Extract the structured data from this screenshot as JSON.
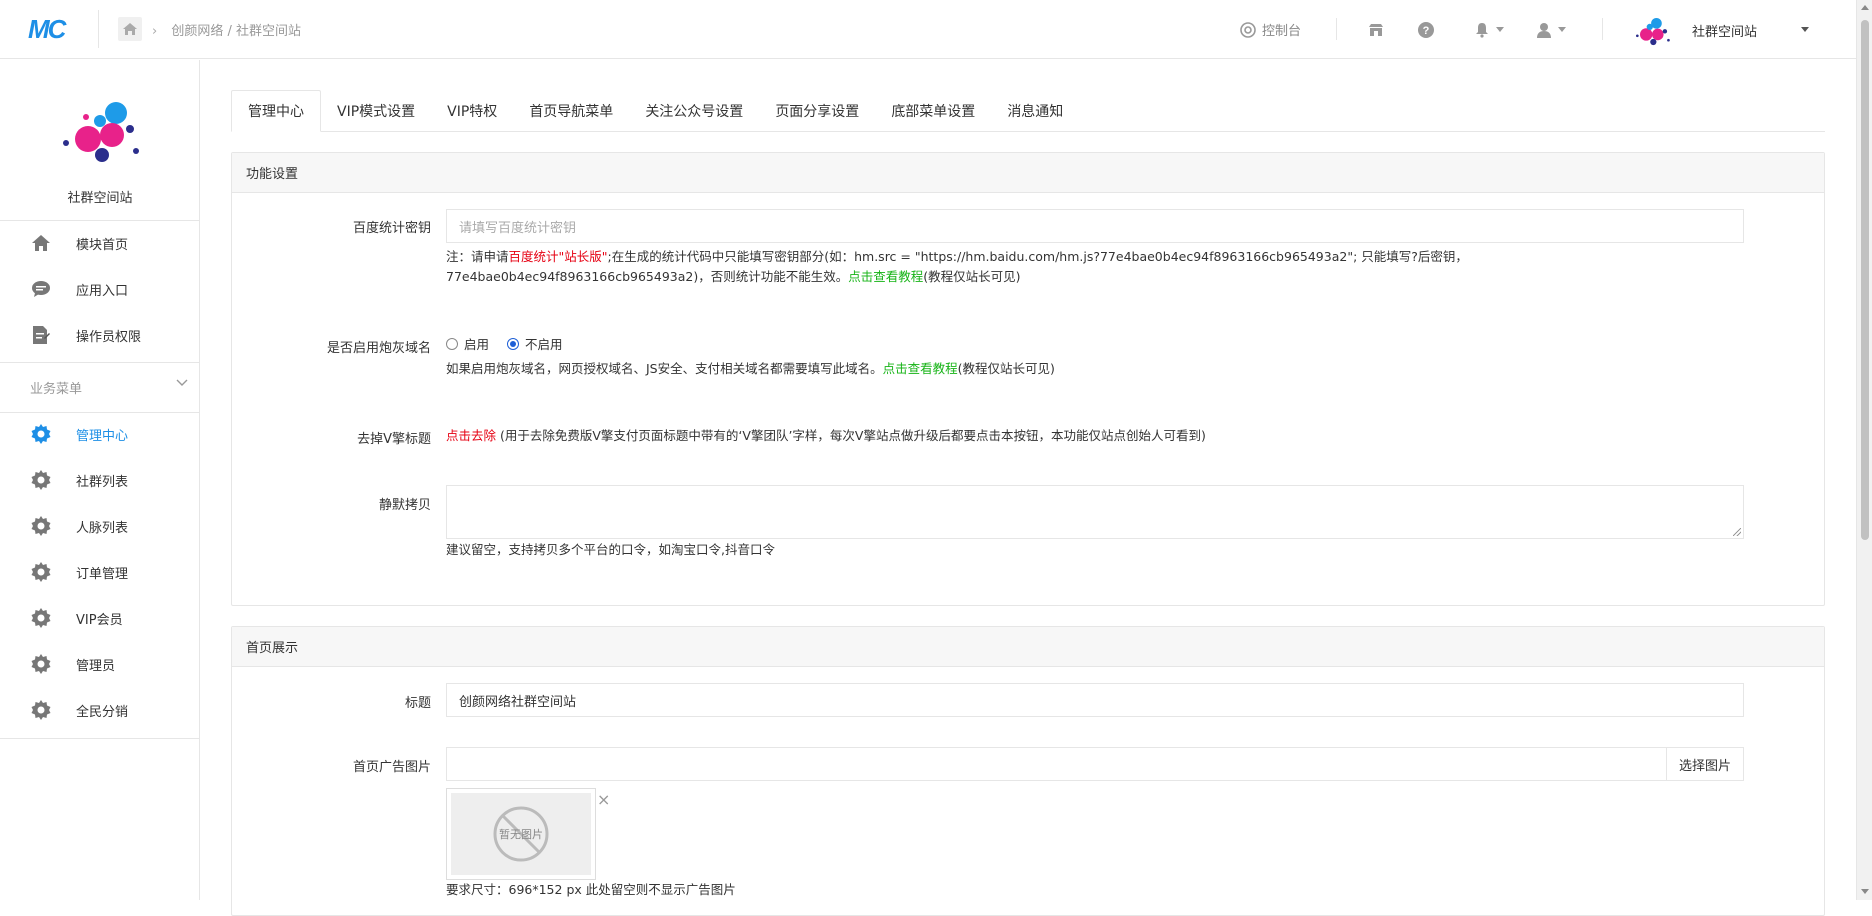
{
  "header": {
    "logo_text": "MC",
    "breadcrumb": [
      "创颜网络",
      "社群空间站"
    ],
    "console_label": "控制台",
    "site_name": "社群空间站"
  },
  "sidebar": {
    "site_title": "社群空间站",
    "top_items": [
      {
        "label": "模块首页",
        "icon": "home-icon"
      },
      {
        "label": "应用入口",
        "icon": "chat-icon"
      },
      {
        "label": "操作员权限",
        "icon": "document-edit-icon"
      }
    ],
    "section_label": "业务菜单",
    "business_items": [
      {
        "label": "管理中心",
        "icon": "gear-icon",
        "active": true
      },
      {
        "label": "社群列表",
        "icon": "gear-icon"
      },
      {
        "label": "人脉列表",
        "icon": "gear-icon"
      },
      {
        "label": "订单管理",
        "icon": "gear-icon"
      },
      {
        "label": "VIP会员",
        "icon": "gear-icon"
      },
      {
        "label": "管理员",
        "icon": "gear-icon"
      },
      {
        "label": "全民分销",
        "icon": "gear-icon"
      }
    ]
  },
  "tabs": [
    "管理中心",
    "VIP模式设置",
    "VIP特权",
    "首页导航菜单",
    "关注公众号设置",
    "页面分享设置",
    "底部菜单设置",
    "消息通知"
  ],
  "function_settings": {
    "title": "功能设置",
    "baidu_label": "百度统计密钥",
    "baidu_placeholder": "请填写百度统计密钥",
    "baidu_note_prefix": "注：请申请",
    "baidu_note_red": "百度统计\"站长版\"",
    "baidu_note_mid": ";在生成的统计代码中只能填写密钥部分(如：hm.src = \"https://hm.baidu.com/hm.js?77e4bae0b4ec94f8963166cb965493a2\"; 只能填写?后密钥，",
    "baidu_note_line2": "77e4bae0b4ec94f8963166cb965493a2)，否则统计功能不能生效。",
    "tutorial_link": "点击查看教程",
    "tutorial_suffix": "(教程仅站长可见)",
    "cannon_label": "是否启用炮灰域名",
    "radio_on": "启用",
    "radio_off": "不启用",
    "radio_selected": "不启用",
    "cannon_note": "如果启用炮灰域名，网页授权域名、JS安全、支付相关域名都需要填写此域名。",
    "remove_label": "去掉V擎标题",
    "remove_link": "点击去除",
    "remove_note": " (用于去除免费版V擎支付页面标题中带有的‘V擎团队’字样，每次V擎站点做升级后都要点击本按钮，本功能仅站点创始人可看到)",
    "silent_label": "静默拷贝",
    "silent_value": "",
    "silent_note": "建议留空，支持拷贝多个平台的口令，如淘宝口令,抖音口令"
  },
  "home_display": {
    "title": "首页展示",
    "title_label": "标题",
    "title_value": "创颜网络社群空间站",
    "ad_label": "首页广告图片",
    "ad_value": "",
    "select_button": "选择图片",
    "no_image_text": "暂无图片",
    "size_note": "要求尺寸：696*152 px 此处留空则不显示广告图片"
  }
}
